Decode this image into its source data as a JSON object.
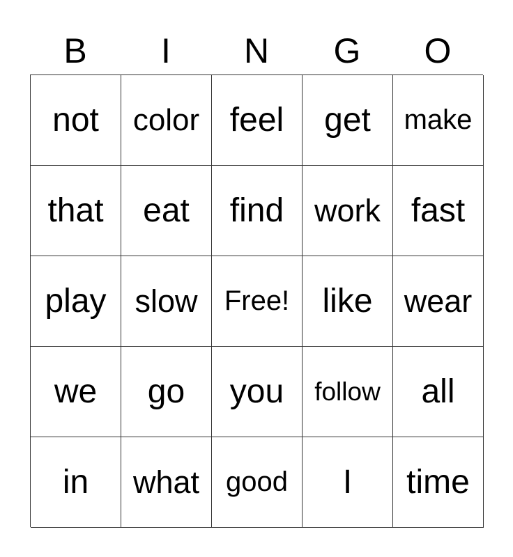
{
  "header": [
    "B",
    "I",
    "N",
    "G",
    "O"
  ],
  "grid": [
    [
      "not",
      "color",
      "feel",
      "get",
      "make"
    ],
    [
      "that",
      "eat",
      "find",
      "work",
      "fast"
    ],
    [
      "play",
      "slow",
      "Free!",
      "like",
      "wear"
    ],
    [
      "we",
      "go",
      "you",
      "follow",
      "all"
    ],
    [
      "in",
      "what",
      "good",
      "I",
      "time"
    ]
  ]
}
